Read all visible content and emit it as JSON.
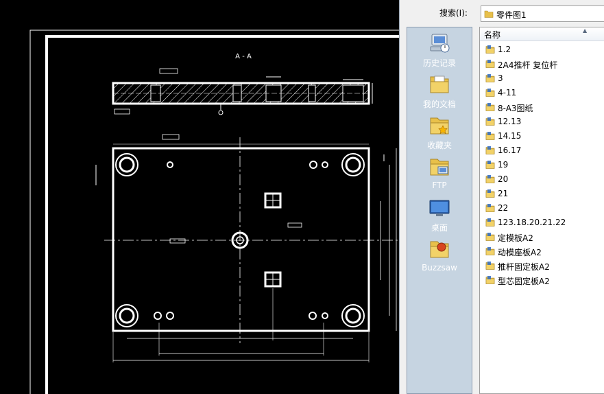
{
  "cad": {
    "section_label": "A - A"
  },
  "dialog": {
    "search_label": "搜索(I):",
    "current_folder": "零件图1",
    "places": [
      {
        "label": "历史记录",
        "icon": "history-icon"
      },
      {
        "label": "我的文档",
        "icon": "documents-folder-icon"
      },
      {
        "label": "收藏夹",
        "icon": "favorites-folder-icon"
      },
      {
        "label": "FTP",
        "icon": "ftp-icon"
      },
      {
        "label": "桌面",
        "icon": "desktop-icon"
      },
      {
        "label": "Buzzsaw",
        "icon": "buzzsaw-icon"
      }
    ],
    "column_header": "名称",
    "files": [
      {
        "name": "1.2"
      },
      {
        "name": "2A4推杆 复位杆"
      },
      {
        "name": "3"
      },
      {
        "name": "4-11"
      },
      {
        "name": "8-A3图纸"
      },
      {
        "name": "12.13"
      },
      {
        "name": "14.15"
      },
      {
        "name": "16.17"
      },
      {
        "name": "19"
      },
      {
        "name": "20"
      },
      {
        "name": "21"
      },
      {
        "name": "22"
      },
      {
        "name": "123.18.20.21.22"
      },
      {
        "name": "定模板A2"
      },
      {
        "name": "动模座板A2"
      },
      {
        "name": "推杆固定板A2"
      },
      {
        "name": "型芯固定板A2"
      }
    ],
    "colors": {
      "places_bg": "#c6d4e1",
      "folder": "#e8c04a"
    }
  }
}
